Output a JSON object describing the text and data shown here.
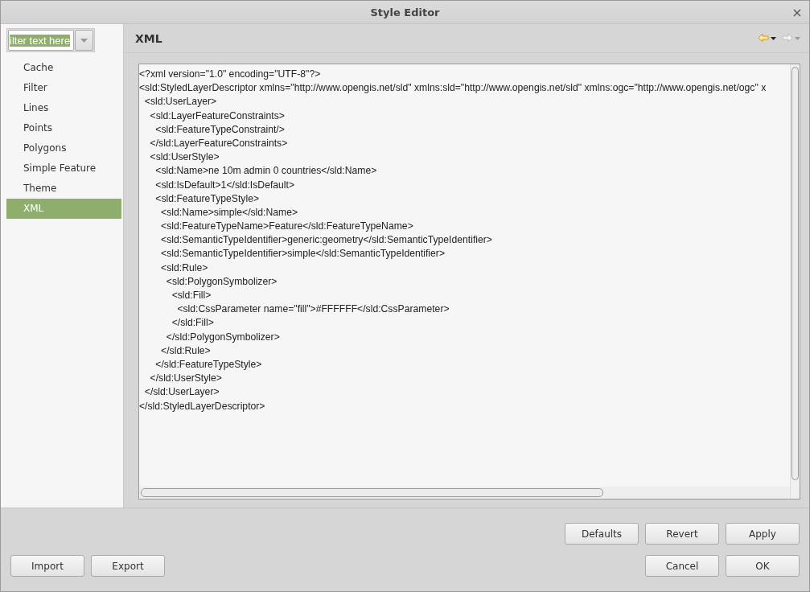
{
  "window": {
    "title": "Style Editor",
    "close": "×"
  },
  "filter": {
    "value": "ilter text here",
    "selected_text": true
  },
  "sidebar": {
    "items": [
      {
        "label": "Cache",
        "selected": false
      },
      {
        "label": "Filter",
        "selected": false
      },
      {
        "label": "Lines",
        "selected": false
      },
      {
        "label": "Points",
        "selected": false
      },
      {
        "label": "Polygons",
        "selected": false
      },
      {
        "label": "Simple Feature",
        "selected": false
      },
      {
        "label": "Theme",
        "selected": false
      },
      {
        "label": "XML",
        "selected": true
      }
    ]
  },
  "page": {
    "title": "XML",
    "nav": [
      {
        "kind": "back",
        "disabled": false
      },
      {
        "kind": "forward",
        "disabled": true
      }
    ]
  },
  "editor": {
    "lines": [
      "<?xml version=\"1.0\" encoding=\"UTF-8\"?>",
      "<sld:StyledLayerDescriptor xmlns=\"http://www.opengis.net/sld\" xmlns:sld=\"http://www.opengis.net/sld\" xmlns:ogc=\"http://www.opengis.net/ogc\" x",
      "  <sld:UserLayer>",
      "    <sld:LayerFeatureConstraints>",
      "      <sld:FeatureTypeConstraint/>",
      "    </sld:LayerFeatureConstraints>",
      "    <sld:UserStyle>",
      "      <sld:Name>ne 10m admin 0 countries</sld:Name>",
      "      <sld:IsDefault>1</sld:IsDefault>",
      "      <sld:FeatureTypeStyle>",
      "        <sld:Name>simple</sld:Name>",
      "        <sld:FeatureTypeName>Feature</sld:FeatureTypeName>",
      "        <sld:SemanticTypeIdentifier>generic:geometry</sld:SemanticTypeIdentifier>",
      "        <sld:SemanticTypeIdentifier>simple</sld:SemanticTypeIdentifier>",
      "        <sld:Rule>",
      "          <sld:PolygonSymbolizer>",
      "            <sld:Fill>",
      "              <sld:CssParameter name=\"fill\">#FFFFFF</sld:CssParameter>",
      "            </sld:Fill>",
      "          </sld:PolygonSymbolizer>",
      "        </sld:Rule>",
      "      </sld:FeatureTypeStyle>",
      "    </sld:UserStyle>",
      "  </sld:UserLayer>",
      "</sld:StyledLayerDescriptor>"
    ]
  },
  "buttons": {
    "right_top": [
      "Defaults",
      "Revert",
      "Apply"
    ],
    "left": [
      "Import",
      "Export"
    ],
    "right_bottom": [
      "Cancel",
      "OK"
    ]
  }
}
